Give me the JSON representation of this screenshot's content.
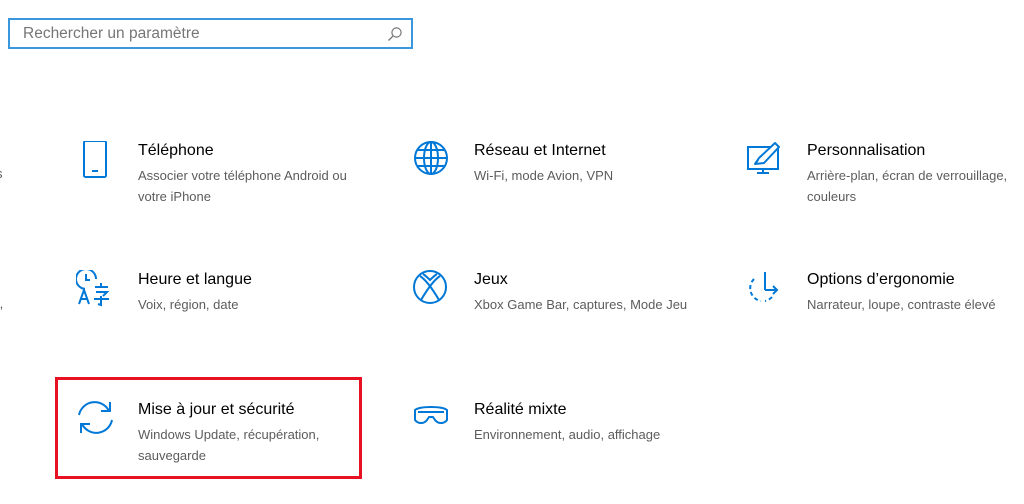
{
  "search": {
    "placeholder": "Rechercher un paramètre"
  },
  "left_clip": {
    "row1": "s",
    "row2": "t,"
  },
  "tiles": [
    {
      "title": "Téléphone",
      "desc": "Associer votre téléphone Android ou votre iPhone",
      "icon": "phone-icon"
    },
    {
      "title": "Réseau et Internet",
      "desc": "Wi-Fi, mode Avion, VPN",
      "icon": "globe-icon"
    },
    {
      "title": "Personnalisation",
      "desc": "Arrière-plan, écran de verrouillage, couleurs",
      "icon": "personalization-icon"
    },
    {
      "title": "Heure et langue",
      "desc": "Voix, région, date",
      "icon": "time-language-icon"
    },
    {
      "title": "Jeux",
      "desc": "Xbox Game Bar, captures, Mode Jeu",
      "icon": "xbox-icon"
    },
    {
      "title": "Options d’ergonomie",
      "desc": "Narrateur, loupe, contraste élevé",
      "icon": "ease-of-access-icon"
    },
    {
      "title": "Mise à jour et sécurité",
      "desc": "Windows Update, récupération, sauvegarde",
      "icon": "update-sync-icon"
    },
    {
      "title": "Réalité mixte",
      "desc": "Environnement, audio, affichage",
      "icon": "mixed-reality-headset-icon"
    }
  ],
  "colors": {
    "accent": "#0078d7",
    "search_border": "#3a96dd",
    "highlight": "#e81123"
  }
}
